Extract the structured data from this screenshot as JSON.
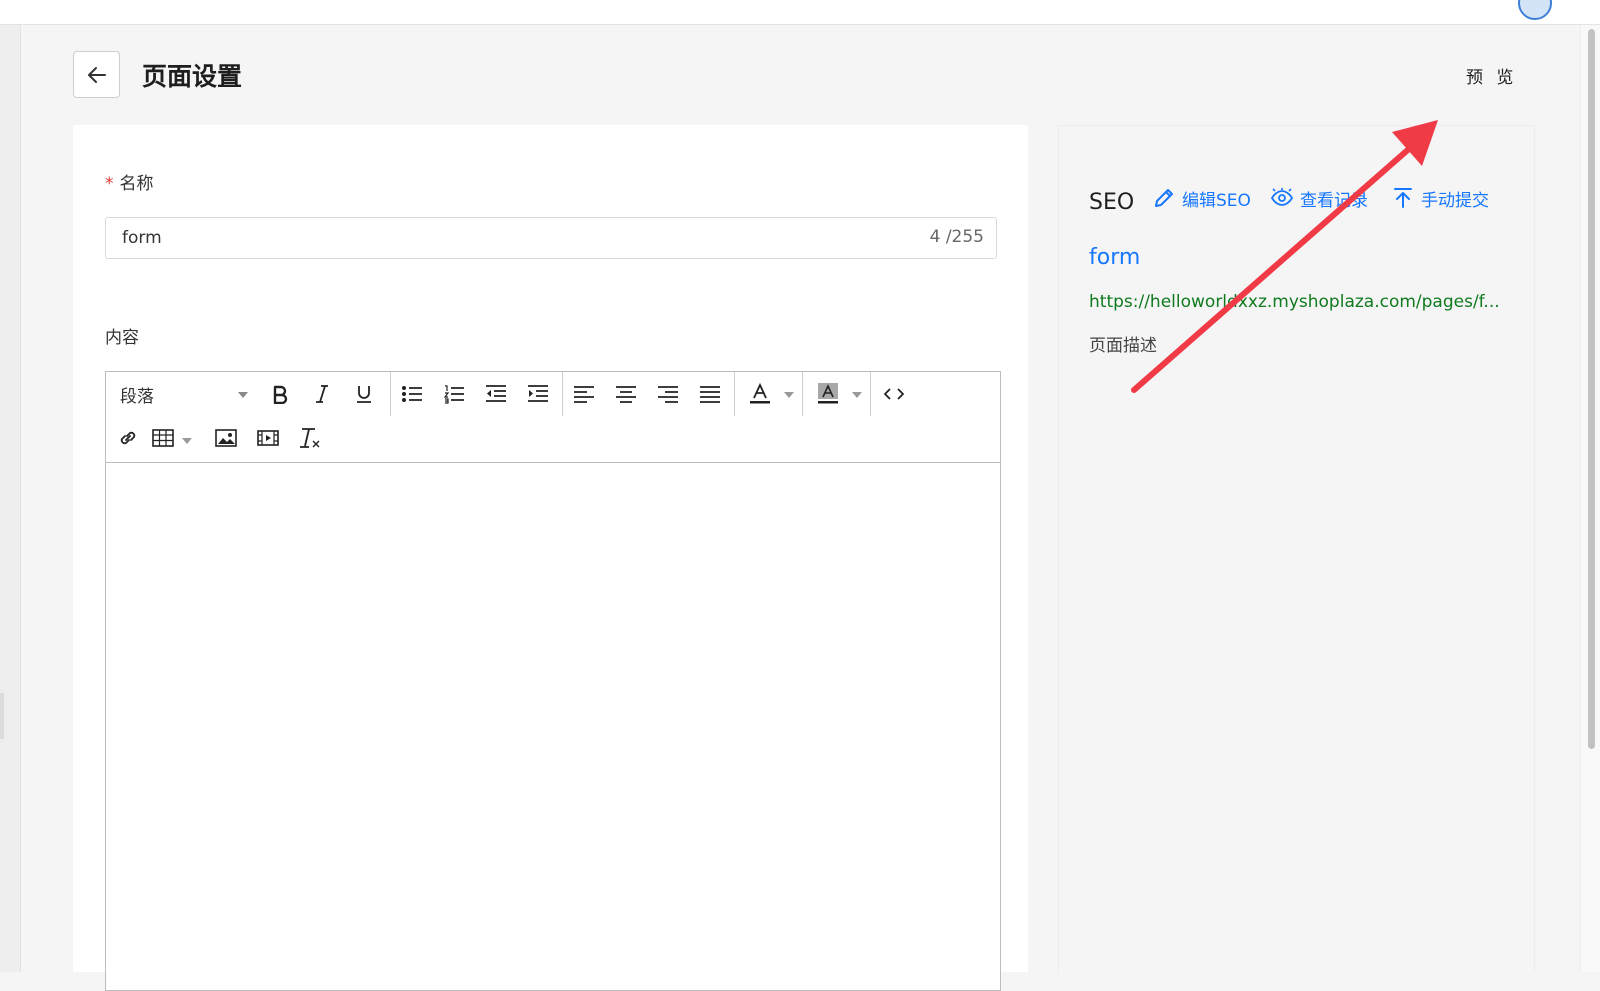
{
  "header": {
    "title": "页面设置",
    "preview_label": "预 览"
  },
  "form": {
    "name_required_mark": "*",
    "name_label": "名称",
    "name_value": "form",
    "name_count": "4 /255",
    "content_label": "内容"
  },
  "editor": {
    "paragraph_label": "段落",
    "toolbar_icons": [
      "bold-icon",
      "italic-icon",
      "underline-icon",
      "bullet-list-icon",
      "numbered-list-icon",
      "outdent-icon",
      "indent-icon",
      "align-left-icon",
      "align-center-icon",
      "align-right-icon",
      "align-justify-icon",
      "text-color-icon",
      "background-color-icon",
      "code-view-icon",
      "link-icon",
      "table-icon",
      "image-icon",
      "video-icon",
      "clear-format-icon"
    ]
  },
  "seo": {
    "title": "SEO",
    "edit_label": "编辑SEO",
    "view_label": "查看记录",
    "submit_label": "手动提交",
    "link_title": "form",
    "url": "https://helloworldxxz.myshoplaza.com/pages/f...",
    "description": "页面描述"
  },
  "colors": {
    "link_blue": "#1677ff",
    "url_green": "#0f7a1e",
    "annotation_red": "#f03a46",
    "required_red": "#e03a3a"
  }
}
